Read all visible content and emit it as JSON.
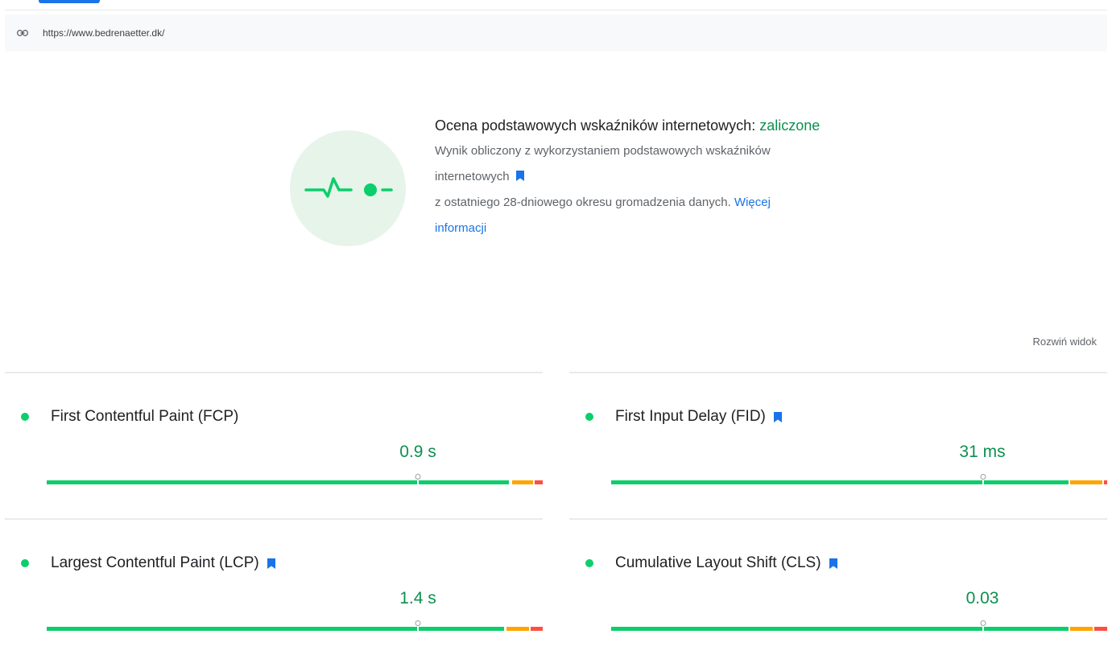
{
  "url": {
    "icon": "link-icon",
    "text": "https://www.bedrenaetter.dk/"
  },
  "summary": {
    "icon": "cwv-pulse-icon",
    "title_prefix": "Ocena podstawowych wskaźników internetowych:",
    "title_status": "zaliczone",
    "description_part1": "Wynik obliczony z wykorzystaniem podstawowych wskaźników internetowych",
    "description_part2": "z ostatniego 28-dniowego okresu gromadzenia danych.",
    "learn_more": "Więcej informacji"
  },
  "expand_view": "Rozwiń widok",
  "metrics": [
    {
      "name": "First Contentful Paint (FCP)",
      "value": "0.9 s",
      "core": false,
      "status": "good",
      "distribution": [
        0.93,
        0.05,
        0.02
      ]
    },
    {
      "name": "First Input Delay (FID)",
      "value": "31 ms",
      "core": true,
      "status": "good",
      "distribution": [
        0.93,
        0.07,
        0.005
      ]
    },
    {
      "name": "Largest Contentful Paint (LCP)",
      "value": "1.4 s",
      "core": true,
      "status": "good",
      "distribution": [
        0.925,
        0.045,
        0.03
      ]
    },
    {
      "name": "Cumulative Layout Shift (CLS)",
      "value": "0.03",
      "core": true,
      "status": "good",
      "distribution": [
        0.93,
        0.045,
        0.025
      ]
    }
  ],
  "colors": {
    "good": "#0cce6b",
    "needs_improvement": "#ffa400",
    "poor": "#ff4e42",
    "accent": "#1a73e8",
    "pass_text": "#0d904f"
  }
}
